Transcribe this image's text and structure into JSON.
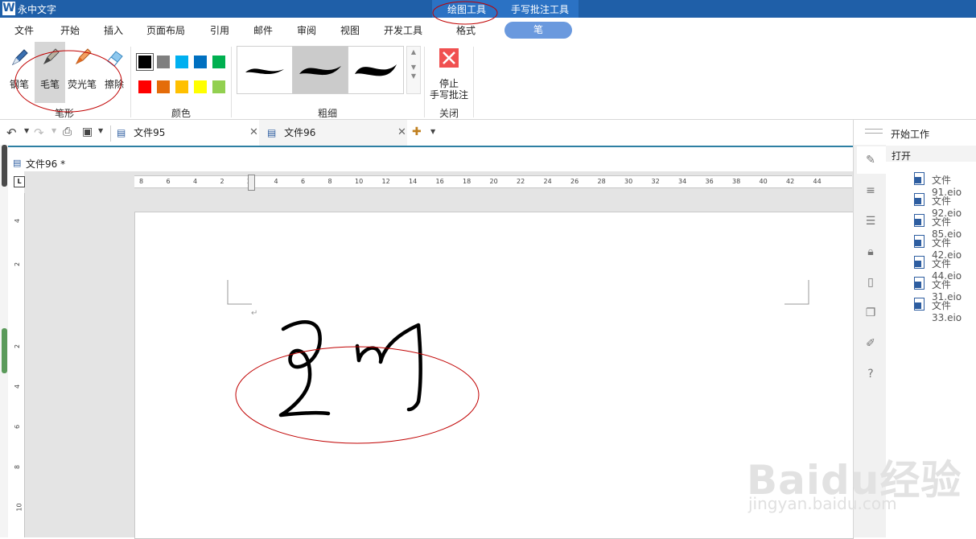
{
  "app": {
    "title": "永中文字",
    "logo_letter": "W"
  },
  "context_tabs": [
    "绘图工具",
    "手写批注工具"
  ],
  "menu": [
    "文件",
    "开始",
    "插入",
    "页面布局",
    "引用",
    "邮件",
    "审阅",
    "视图",
    "开发工具",
    "格式"
  ],
  "active_tab": "笔",
  "ribbon": {
    "pen_types": [
      "钢笔",
      "毛笔",
      "荧光笔",
      "擦除"
    ],
    "pen_group_label": "笔形",
    "color_group_label": "颜色",
    "colors_row1": [
      "#000000",
      "#7f7f7f",
      "#00b0f0",
      "#0070c0",
      "#00b050"
    ],
    "colors_row2": [
      "#ff0000",
      "#e46c0a",
      "#ffc000",
      "#ffff00",
      "#92d050"
    ],
    "thickness_group_label": "粗细",
    "stop_label_1": "停止",
    "stop_label_2": "手写批注",
    "close_group_label": "关闭"
  },
  "doc_tabs": [
    "文件95",
    "文件96"
  ],
  "doc_label": "文件96 *",
  "ruler_h": [
    "8",
    "6",
    "4",
    "2",
    "2",
    "4",
    "6",
    "8",
    "10",
    "12",
    "14",
    "16",
    "18",
    "20",
    "22",
    "24",
    "26",
    "28",
    "30",
    "32",
    "34",
    "36",
    "38",
    "40",
    "42",
    "44"
  ],
  "ruler_v": [
    "4",
    "2",
    "2",
    "4",
    "6",
    "8",
    "10"
  ],
  "panel": {
    "header": "开始工作",
    "open_label": "打开",
    "files": [
      "文件91.eio",
      "文件92.eio",
      "文件85.eio",
      "文件42.eio",
      "文件44.eio",
      "文件31.eio",
      "文件33.eio"
    ]
  },
  "watermark": {
    "main": "Baidu经验",
    "sub": "jingyan.baidu.com"
  },
  "accent_colors": {
    "title_bar": "#1f5fa8",
    "pen_tab": "#6a99de",
    "annotation_red": "#c00000"
  }
}
